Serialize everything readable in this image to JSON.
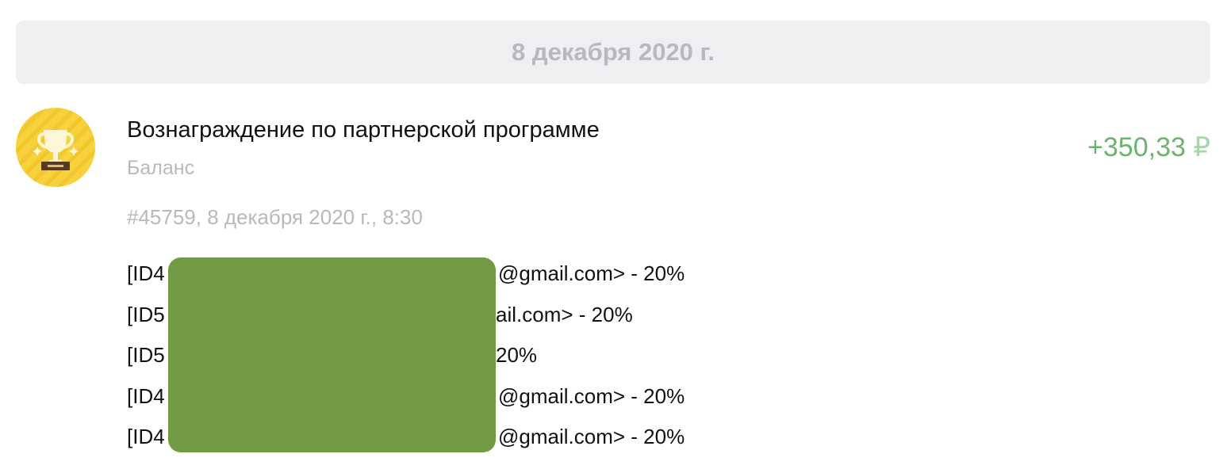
{
  "date_header": "8 декабря 2020 г.",
  "transaction": {
    "icon": "trophy-icon",
    "title": "Вознаграждение по партнерской программе",
    "account": "Баланс",
    "amount": "+350,33",
    "currency": "₽",
    "meta": "#45759, 8 декабря 2020 г., 8:30"
  },
  "comment_lines": [
    {
      "visible_start": "[ID4",
      "visible_end": "@gmail.com> - 20%"
    },
    {
      "visible_start": "[ID5",
      "visible_end": "ail.com> - 20%"
    },
    {
      "visible_start": "[ID5",
      "visible_end": "20%"
    },
    {
      "visible_start": "[ID4",
      "visible_end": "@gmail.com> - 20%"
    },
    {
      "visible_start": "[ID4",
      "visible_end": "@gmail.com> - 20%"
    }
  ],
  "colors": {
    "positive_amount": "#6ab46f",
    "redaction": "#729a44",
    "muted_text": "#b8b9bd"
  }
}
